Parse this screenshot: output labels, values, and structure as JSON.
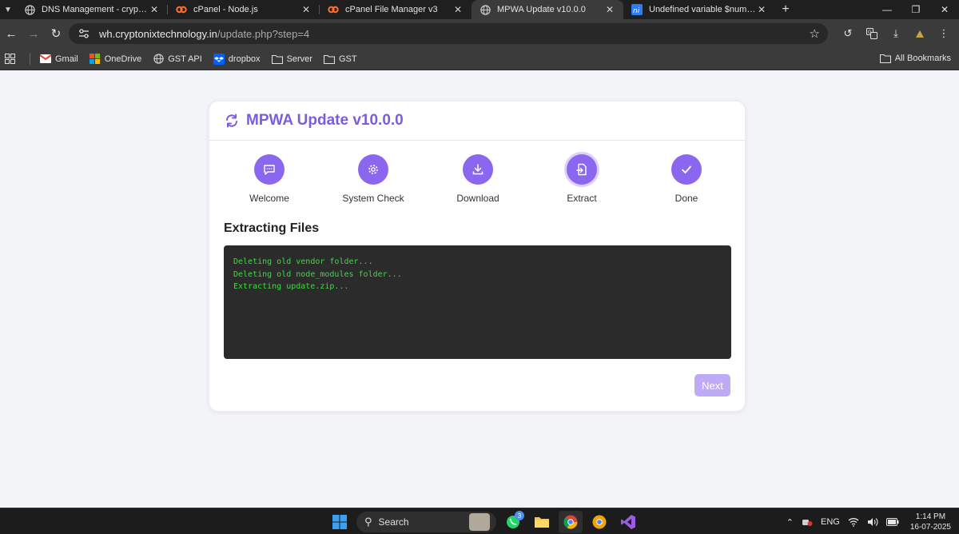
{
  "browser": {
    "tabs": [
      {
        "title": "DNS Management - cryptonixtec",
        "favicon": "globe-icon"
      },
      {
        "title": "cPanel - Node.js",
        "favicon": "cpanel-icon"
      },
      {
        "title": "cPanel File Manager v3",
        "favicon": "cpanel-icon"
      },
      {
        "title": "MPWA Update v10.0.0",
        "favicon": "globe-icon",
        "active": true
      },
      {
        "title": "Undefined variable $numbers",
        "favicon": "ni-icon"
      }
    ],
    "url_host": "wh.cryptonixtechnology.in",
    "url_path": "/update.php?step=4",
    "bookmarks": [
      {
        "label": "Gmail",
        "icon": "gmail-icon"
      },
      {
        "label": "OneDrive",
        "icon": "microsoft-icon"
      },
      {
        "label": "GST API",
        "icon": "globe-icon"
      },
      {
        "label": "dropbox",
        "icon": "dropbox-icon"
      },
      {
        "label": "Server",
        "icon": "folder-icon"
      },
      {
        "label": "GST",
        "icon": "folder-icon"
      }
    ],
    "all_bookmarks": "All Bookmarks"
  },
  "page": {
    "title": "MPWA Update v10.0.0",
    "steps": [
      {
        "label": "Welcome",
        "icon": "chat-icon"
      },
      {
        "label": "System Check",
        "icon": "gear-icon"
      },
      {
        "label": "Download",
        "icon": "download-icon"
      },
      {
        "label": "Extract",
        "icon": "file-extract-icon",
        "current": true
      },
      {
        "label": "Done",
        "icon": "check-icon"
      }
    ],
    "section_title": "Extracting Files",
    "console_lines": [
      "Deleting old vendor folder...",
      "Deleting old node_modules folder...",
      "Extracting update.zip..."
    ],
    "next_label": "Next",
    "accent": "#8b67f0",
    "console_text_color": "#33e03a"
  },
  "taskbar": {
    "search_label": "Search",
    "whatsapp_badge": "3",
    "language": "ENG",
    "time": "1:14 PM",
    "date": "16-07-2025"
  }
}
